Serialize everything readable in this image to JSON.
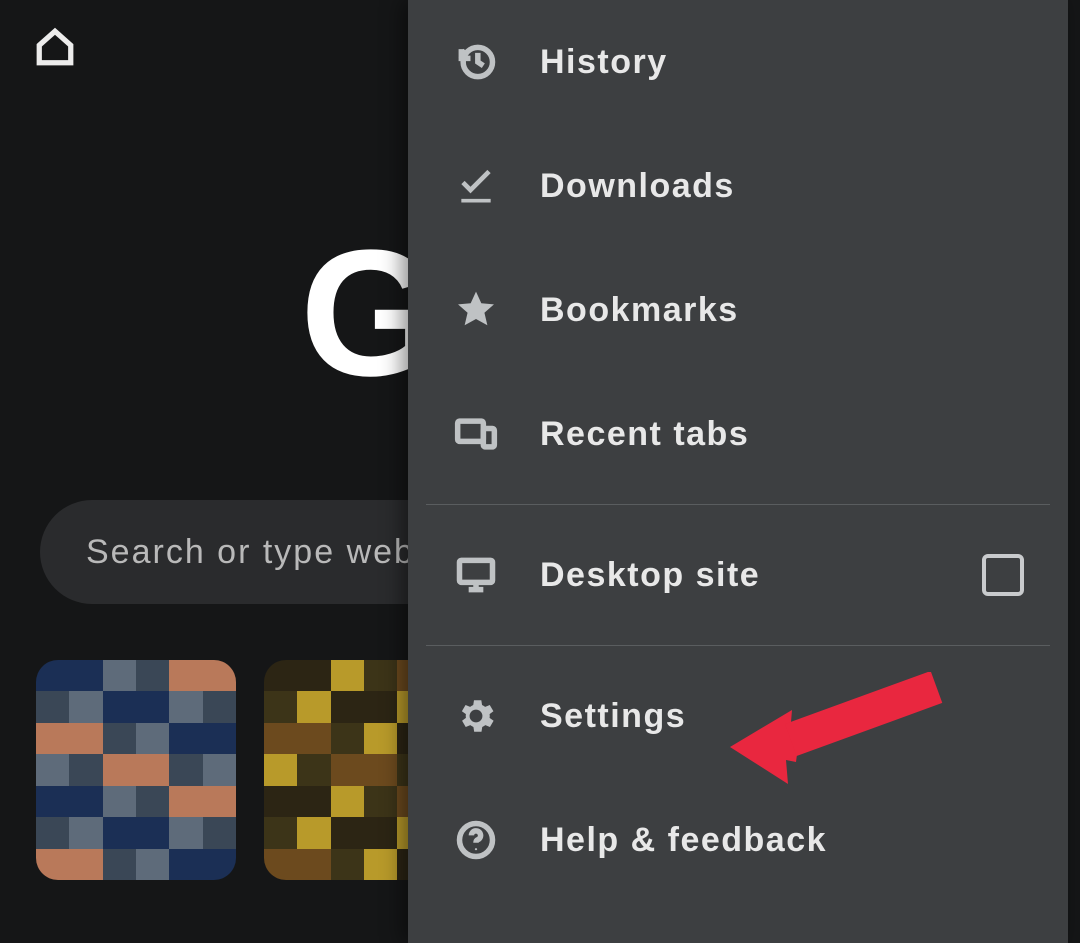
{
  "toolbar": {
    "home_name": "home-icon"
  },
  "page": {
    "logo_text": "G",
    "search_placeholder": "Search or type web address"
  },
  "menu": {
    "items": [
      {
        "icon": "history-icon",
        "label": "History"
      },
      {
        "icon": "download-icon",
        "label": "Downloads"
      },
      {
        "icon": "star-icon",
        "label": "Bookmarks"
      },
      {
        "icon": "recent-tabs-icon",
        "label": "Recent tabs"
      }
    ],
    "desktop_site": {
      "icon": "desktop-icon",
      "label": "Desktop site",
      "checked": false
    },
    "settings": {
      "icon": "gear-icon",
      "label": "Settings"
    },
    "help": {
      "icon": "help-icon",
      "label": "Help & feedback"
    }
  },
  "annotation": {
    "target": "settings",
    "color": "#e9273f"
  }
}
